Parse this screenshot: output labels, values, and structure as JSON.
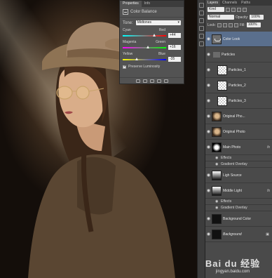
{
  "properties": {
    "tabs": [
      "Properties",
      "Info"
    ],
    "active_tab": "Properties",
    "adjustment_title": "Color Balance",
    "tone_label": "Tone:",
    "tone_value": "Midtones",
    "sliders": [
      {
        "left": "Cyan",
        "right": "Red",
        "value": "+44",
        "fraction": 0.72,
        "gradient": "linear-gradient(90deg,#00ffff,#ff0000)"
      },
      {
        "left": "Magenta",
        "right": "Green",
        "value": "+16",
        "fraction": 0.58,
        "gradient": "linear-gradient(90deg,#ff00ff,#00ff00)"
      },
      {
        "left": "Yellow",
        "right": "Blue",
        "value": "-35",
        "fraction": 0.32,
        "gradient": "linear-gradient(90deg,#ffff00,#0000ff)"
      }
    ],
    "preserve_label": "Preserve Luminosity",
    "preserve_checked": true
  },
  "layers_panel": {
    "tabs": [
      "Layers",
      "Channels",
      "Paths"
    ],
    "active_tab": "Layers",
    "kind_label": "Kind",
    "blend_mode": "Normal",
    "opacity_label": "Opacity:",
    "opacity_value": "100%",
    "lock_label": "Lock:",
    "fill_label": "Fill:",
    "fill_value": "100%",
    "layers": [
      {
        "name": "Color Look",
        "thumb": "adj",
        "selected": true,
        "indent": false,
        "fx": false,
        "italic": false
      },
      {
        "name": "Particles",
        "thumb": "folder",
        "selected": false,
        "indent": false,
        "fx": false,
        "italic": false
      },
      {
        "name": "Particles_1",
        "thumb": "checker",
        "selected": false,
        "indent": true,
        "fx": false,
        "italic": false
      },
      {
        "name": "Particles_2",
        "thumb": "checker",
        "selected": false,
        "indent": true,
        "fx": false,
        "italic": false
      },
      {
        "name": "Particles_3",
        "thumb": "checker",
        "selected": false,
        "indent": true,
        "fx": false,
        "italic": false
      },
      {
        "name": "Original Pho...",
        "thumb": "photo",
        "selected": false,
        "indent": false,
        "fx": false,
        "italic": false
      },
      {
        "name": "Original Photo",
        "thumb": "photo",
        "selected": false,
        "indent": false,
        "fx": false,
        "italic": false
      },
      {
        "name": "Main Photo",
        "thumb": "mask",
        "selected": false,
        "indent": false,
        "fx": true,
        "italic": false,
        "effects": [
          "Effects",
          "Gradient Overlay"
        ]
      },
      {
        "name": "Ligh Source",
        "thumb": "gray",
        "selected": false,
        "indent": false,
        "fx": false,
        "italic": false
      },
      {
        "name": "Middle Light",
        "thumb": "gray",
        "selected": false,
        "indent": false,
        "fx": true,
        "italic": false,
        "effects": [
          "Effects",
          "Gradient Overlay"
        ]
      },
      {
        "name": "Background Color",
        "thumb": "dark",
        "selected": false,
        "indent": false,
        "fx": false,
        "italic": false
      },
      {
        "name": "Background",
        "thumb": "dark",
        "selected": false,
        "indent": false,
        "fx": false,
        "italic": true,
        "locked": true
      }
    ],
    "fx_label": "fx"
  },
  "watermark": {
    "brand": "Bai du 经验",
    "url": "jingyan.baidu.com"
  }
}
